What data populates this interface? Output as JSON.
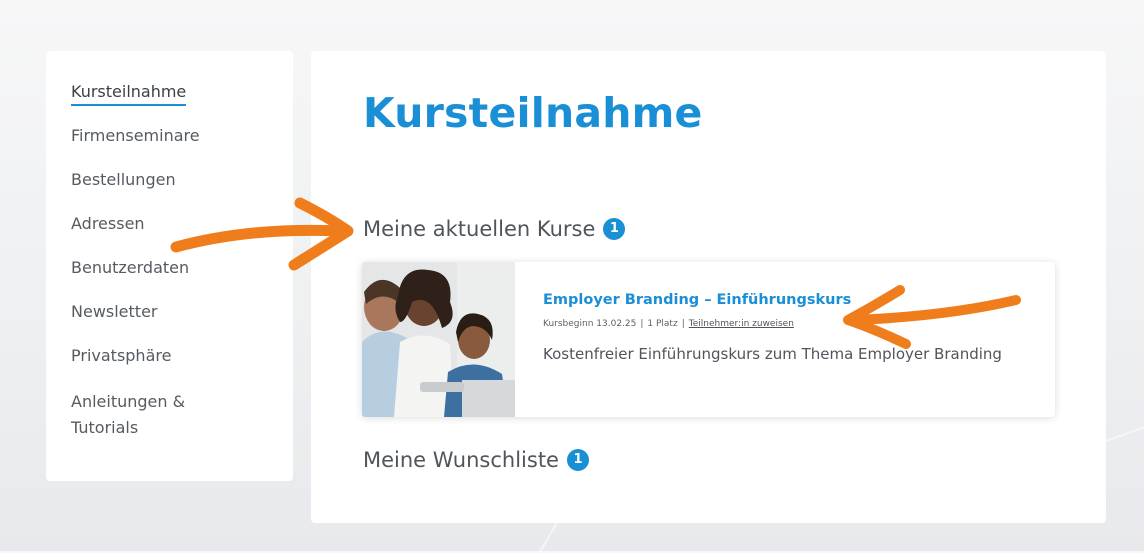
{
  "sidebar": {
    "items": [
      {
        "label": "Kursteilnahme",
        "active": true
      },
      {
        "label": "Firmenseminare",
        "active": false
      },
      {
        "label": "Bestellungen",
        "active": false
      },
      {
        "label": "Adressen",
        "active": false
      },
      {
        "label": "Benutzerdaten",
        "active": false
      },
      {
        "label": "Newsletter",
        "active": false
      },
      {
        "label": "Privatsphäre",
        "active": false
      },
      {
        "label": "Anleitungen & Tutorials",
        "active": false
      }
    ]
  },
  "main": {
    "title": "Kursteilnahme",
    "current_courses": {
      "heading": "Meine aktuellen Kurse",
      "count": "1",
      "items": [
        {
          "title": "Employer Branding – Einführungskurs",
          "start": "Kursbeginn 13.02.25",
          "separator": "|",
          "seats": "1 Platz",
          "assign_link": "Teilnehmer:in zuweisen",
          "description": "Kostenfreier Einführungskurs zum Thema Employer Branding"
        }
      ]
    },
    "wishlist": {
      "heading": "Meine Wunschliste",
      "count": "1"
    }
  },
  "colors": {
    "accent": "#1a8fd6",
    "annotation_arrow": "#f07d1c",
    "text": "#4f555b"
  },
  "icons": {
    "annotation_left": "arrow-right-icon",
    "annotation_right": "arrow-left-icon"
  }
}
